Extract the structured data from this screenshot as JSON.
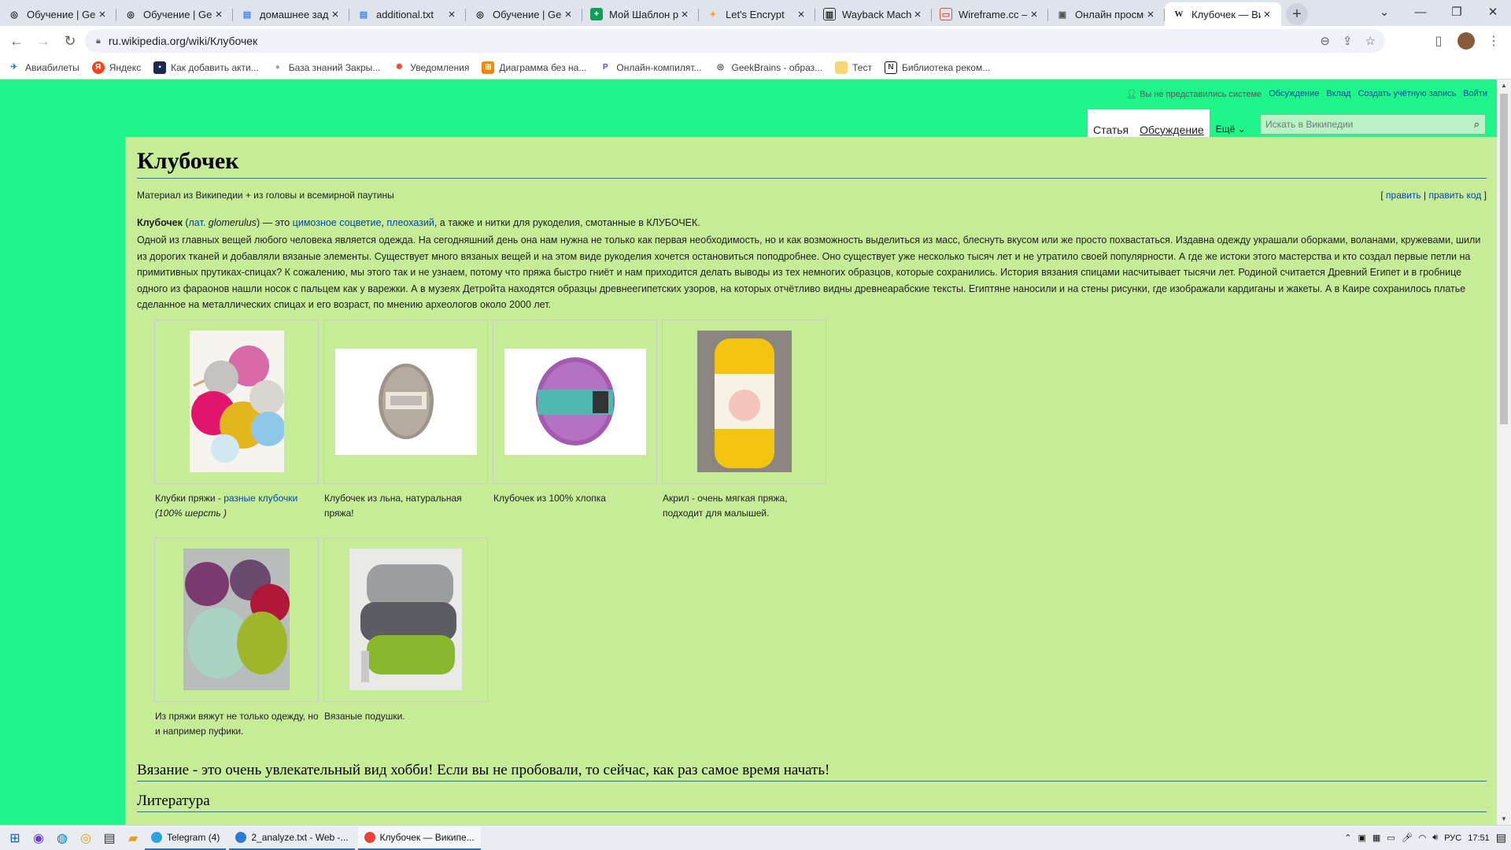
{
  "browser": {
    "tabs": [
      {
        "title": "Обучение | Gee",
        "icon": "geekbrains-icon",
        "color": "#222"
      },
      {
        "title": "Обучение | Gee",
        "icon": "geekbrains-icon",
        "color": "#222"
      },
      {
        "title": "домашнее зада",
        "icon": "docs-icon",
        "color": "#4285f4"
      },
      {
        "title": "additional.txt",
        "icon": "docs-icon",
        "color": "#4285f4"
      },
      {
        "title": "Обучение | Gee",
        "icon": "geekbrains-icon",
        "color": "#222"
      },
      {
        "title": "Мой Шаблон р",
        "icon": "sheets-icon",
        "color": "#0f9d58"
      },
      {
        "title": "Let's Encrypt",
        "icon": "letsencrypt-icon",
        "color": "#f5a623"
      },
      {
        "title": "Wayback Machi",
        "icon": "wayback-icon",
        "color": "#333"
      },
      {
        "title": "Wireframe.cc – ",
        "icon": "wireframe-icon",
        "color": "#e2533c"
      },
      {
        "title": "Онлайн просмс",
        "icon": "monitor-icon",
        "color": "#555"
      },
      {
        "title": "Клубочек — Ви",
        "icon": "wikipedia-icon",
        "color": "#000",
        "active": true
      }
    ],
    "url": "ru.wikipedia.org/wiki/Клубочек",
    "bookmarks": [
      {
        "label": "Авиабилеты",
        "icon": "plane-icon",
        "color": "#1a73e8"
      },
      {
        "label": "Яндекс",
        "icon": "yandex-icon",
        "color": "#fc3f1d"
      },
      {
        "label": "Как добавить акти...",
        "icon": "monitor-icon",
        "color": "#1b2a52"
      },
      {
        "label": "База знаний Закры...",
        "icon": "user-icon",
        "color": "#9aa0a6"
      },
      {
        "label": "Уведомления",
        "icon": "notify-icon",
        "color": "#e2533c"
      },
      {
        "label": "Диаграмма без на...",
        "icon": "diagram-icon",
        "color": "#f08705"
      },
      {
        "label": "Онлайн-компилят...",
        "icon": "compiler-icon",
        "color": "#6b3fd1"
      },
      {
        "label": "GeekBrains - образ...",
        "icon": "geekbrains-icon",
        "color": "#222"
      },
      {
        "label": "Тест",
        "icon": "folder-icon",
        "color": "#f7d774"
      },
      {
        "label": "Библиотека реком...",
        "icon": "notion-icon",
        "color": "#111"
      }
    ]
  },
  "wiki": {
    "personal": {
      "anon": "Вы не представились системе",
      "talk": "Обсуждение",
      "contrib": "Вклад",
      "create": "Создать учётную запись",
      "login": "Войти"
    },
    "tabs": {
      "article": "Статья",
      "talk": "Обсуждение",
      "more": "Ещё"
    },
    "search_placeholder": "Искать в Википедии",
    "title": "Клубочек",
    "tagline": "Материал из Википедии + из головы и всемирной паутины",
    "edit_open": "[",
    "edit": "править",
    "edit_sep": "|",
    "edit_code": "править код",
    "edit_close": "]",
    "lead": {
      "term": "Клубочек",
      "open": " (",
      "lat": "лат.",
      "latin": " glomerulus",
      "close": ") — это ",
      "link1": "цимозное соцветие",
      "comma": ", ",
      "link2": "плеохазий",
      "rest": ", а также и нитки для рукоделия, смотанные в КЛУБОЧЕК."
    },
    "body": "Одной из главных вещей любого человека является одежда. На сегодняшний день она нам нужна не только как первая необходимость, но и как возможность выделиться из масс, блеснуть вкусом или же просто похвастаться. Издавна одежду украшали оборками, воланами, кружевами, шили из дорогих тканей и добавляли вязаные элементы. Существует много вязаных вещей и на этом виде рукоделия хочется остановиться поподробнее. Оно существует уже несколько тысяч лет и не утратило своей популярности. А где же истоки этого мастерства и кто создал первые петли на примитивных прутиках-спицах? К сожалению, мы этого так и не узнаем, потому что пряжа быстро гниёт и нам приходится делать выводы из тех немногих образцов, которые сохранились. История вязания спицами насчитывает тысячи лет. Родиной считается Древний Египет и в гробнице одного из фараонов нашли носок с пальцем как у варежки. А в музеях Детройта находятся образцы древнеегипетских узоров, на которых отчётливо видны древнеарабские тексты. Египтяне наносили и на стены рисунки, где изображали кардиганы и жакеты. А в Каире сохранилось платье сделанное на металлических спицах и его возраст, по мнению археологов около 2000 лет.",
    "gallery": [
      {
        "cap_pre": "Клубки пряжи - ",
        "cap_link": "разные клубочки",
        "cap_post": "",
        "cap_line2": "(100% шерсть )"
      },
      {
        "cap_pre": "Клубочек из льна, натуральная пряжа!",
        "cap_link": "",
        "cap_post": "",
        "cap_line2": ""
      },
      {
        "cap_pre": "Клубочек из 100% хлопка",
        "cap_link": "",
        "cap_post": "",
        "cap_line2": ""
      },
      {
        "cap_pre": "Акрил - очень мягкая пряжа, подходит для малышей.",
        "cap_link": "",
        "cap_post": "",
        "cap_line2": ""
      },
      {
        "cap_pre": "Из пряжи вяжут не только одежду, но и например пуфики.",
        "cap_link": "",
        "cap_post": "",
        "cap_line2": ""
      },
      {
        "cap_pre": "Вязаные подушки.",
        "cap_link": "",
        "cap_post": "",
        "cap_line2": ""
      }
    ],
    "heading1": "Вязание - это очень увлекательный вид хобби! Если вы не пробовали, то сейчас, как раз самое время начать!",
    "heading2": "Литература"
  },
  "taskbar": {
    "apps": [
      {
        "label": "Telegram (4)",
        "color": "#2aa3df"
      },
      {
        "label": "2_analyze.txt - Web -...",
        "color": "#2c7ad6"
      },
      {
        "label": "Клубочек — Википе...",
        "color": "#e94335"
      }
    ],
    "lang": "РУС",
    "time": "17:51"
  },
  "colors": {
    "page_bg": "#20f589",
    "content_bg": "#c6ec98",
    "link": "#0645ad"
  }
}
